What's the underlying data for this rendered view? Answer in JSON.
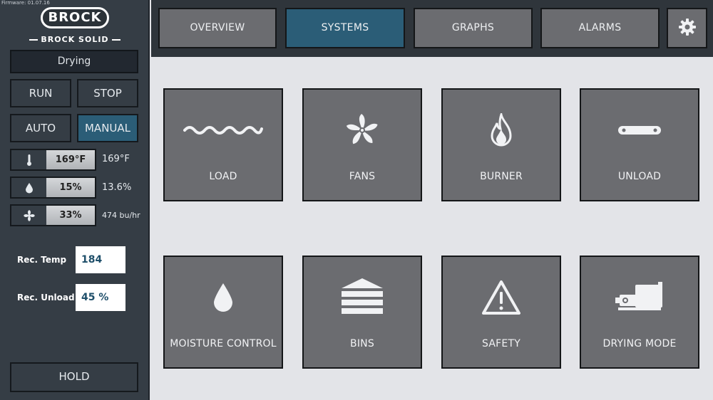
{
  "firmware": "Firmware: 01.07.16",
  "logo": {
    "name": "BROCK",
    "tagline": "BROCK SOLID"
  },
  "status": "Drying",
  "controls": {
    "run": "RUN",
    "stop": "STOP",
    "auto": "AUTO",
    "manual": "MANUAL",
    "hold": "HOLD"
  },
  "readings": [
    {
      "icon": "thermometer-icon",
      "value": "169°F",
      "actual": "169°F"
    },
    {
      "icon": "droplet-icon",
      "value": "15%",
      "actual": "13.6%"
    },
    {
      "icon": "fan-icon",
      "value": "33%",
      "actual": "474 bu/hr"
    }
  ],
  "rec": {
    "temp_label": "Rec. Temp",
    "temp_value": "184",
    "unload_label": "Rec. Unload",
    "unload_value": "45 %"
  },
  "tabs": {
    "overview": "OVERVIEW",
    "systems": "SYSTEMS",
    "graphs": "GRAPHS",
    "alarms": "ALARMS"
  },
  "active_tab": "SYSTEMS",
  "tiles": {
    "load": "LOAD",
    "fans": "FANS",
    "burner": "BURNER",
    "unload": "UNLOAD",
    "moisture": "MOISTURE CONTROL",
    "bins": "BINS",
    "safety": "SAFETY",
    "drying": "DRYING MODE"
  },
  "colors": {
    "accent": "#2b5d77",
    "tile": "#6b6c70",
    "sidebar": "#353d45",
    "background": "#e3e4e8"
  }
}
